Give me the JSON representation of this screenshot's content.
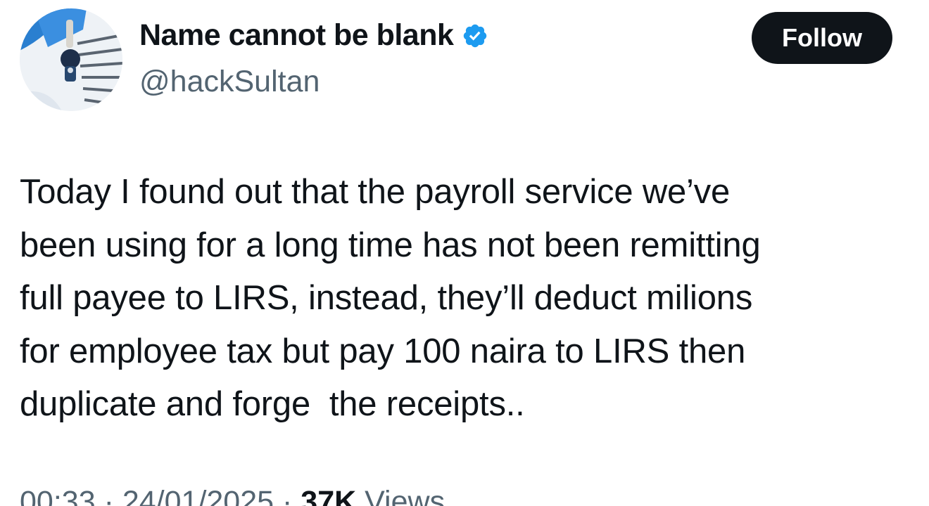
{
  "author": {
    "display_name": "Name cannot be blank",
    "handle": "@hackSultan",
    "verified": true,
    "verified_color": "#1d9bf0",
    "avatar_icon": "profile-photo"
  },
  "follow_button": {
    "label": "Follow"
  },
  "tweet": {
    "text": "Today I found out that the payroll service we’ve\nbeen using for a long time has not been remitting\nfull payee to LIRS, instead, they’ll deduct milions\nfor employee tax but pay 100 naira to LIRS then\nduplicate and forge  the receipts..",
    "time": "00:33",
    "date": "24/01/2025",
    "separator": "·",
    "views_count": "37K",
    "views_label": "Views"
  },
  "colors": {
    "text": "#0f1419",
    "secondary_text": "#536471",
    "follow_bg": "#0f1419",
    "follow_text": "#ffffff"
  }
}
